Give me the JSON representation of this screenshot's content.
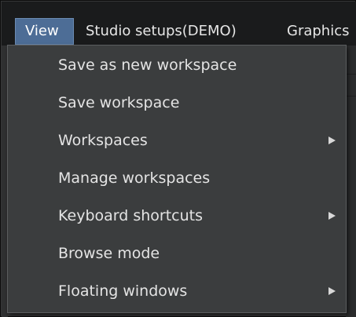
{
  "menubar": {
    "items": [
      {
        "label": "View"
      },
      {
        "label": "Studio setups(DEMO)"
      },
      {
        "label": "Graphics"
      }
    ]
  },
  "dropdown": {
    "items": [
      {
        "label": "Save as new workspace",
        "submenu": false
      },
      {
        "label": "Save workspace",
        "submenu": false
      },
      {
        "label": "Workspaces",
        "submenu": true
      },
      {
        "label": "Manage workspaces",
        "submenu": false
      },
      {
        "label": "Keyboard shortcuts",
        "submenu": true
      },
      {
        "label": "Browse mode",
        "submenu": false
      },
      {
        "label": "Floating windows",
        "submenu": true
      }
    ]
  },
  "icons": {
    "submenu_arrow": "triangle-right-icon"
  },
  "colors": {
    "menubar_bg": "#1a1b1c",
    "active_menu_bg": "#4d6d96",
    "dropdown_bg": "#3b3d3e",
    "text": "#e4e4e4"
  }
}
